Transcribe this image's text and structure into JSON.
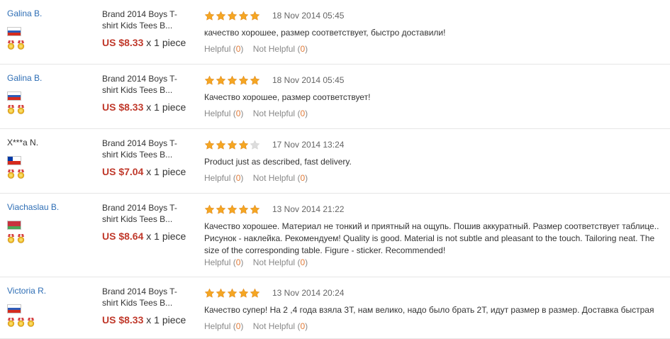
{
  "reviews": [
    {
      "username": "Galina B.",
      "username_link": true,
      "country": "ru",
      "medals": 2,
      "product_title": "Brand 2014 Boys T-shirt Kids Tees B...",
      "price": "US $8.33",
      "qty": " x 1 piece",
      "rating": 5,
      "date": "18 Nov 2014 05:45",
      "feedback": "качество хорошее, размер соответствует, быстро доставили!",
      "helpful_label": "Helpful",
      "helpful_count": "0",
      "not_helpful_label": "Not Helpful",
      "not_helpful_count": "0"
    },
    {
      "username": "Galina B.",
      "username_link": true,
      "country": "ru",
      "medals": 2,
      "product_title": "Brand 2014 Boys T-shirt Kids Tees B...",
      "price": "US $8.33",
      "qty": " x 1 piece",
      "rating": 5,
      "date": "18 Nov 2014 05:45",
      "feedback": "Качество хорошее, размер соответствует!",
      "helpful_label": "Helpful",
      "helpful_count": "0",
      "not_helpful_label": "Not Helpful",
      "not_helpful_count": "0"
    },
    {
      "username": "X***a N.",
      "username_link": false,
      "country": "cl",
      "medals": 2,
      "product_title": "Brand 2014 Boys T-shirt Kids Tees B...",
      "price": "US $7.04",
      "qty": " x 1 piece",
      "rating": 4,
      "date": "17 Nov 2014 13:24",
      "feedback": "Product just as described, fast delivery.",
      "helpful_label": "Helpful",
      "helpful_count": "0",
      "not_helpful_label": "Not Helpful",
      "not_helpful_count": "0"
    },
    {
      "username": "Viachaslau B.",
      "username_link": true,
      "country": "by",
      "medals": 2,
      "product_title": "Brand 2014 Boys T-shirt Kids Tees B...",
      "price": "US $8.64",
      "qty": " x 1 piece",
      "rating": 5,
      "date": "13 Nov 2014 21:22",
      "feedback": "Качество хорошее. Материал не тонкий и приятный на ощупь. Пошив аккуратный. Размер соответствует таблице.. Рисунок - наклейка. Рекомендуем! Quality is good. Material is not subtle and pleasant to the touch. Tailoring neat. The size of the corresponding table. Figure - sticker. Recommended!",
      "helpful_label": "Helpful",
      "helpful_count": "0",
      "not_helpful_label": "Not Helpful",
      "not_helpful_count": "0"
    },
    {
      "username": "Victoria R.",
      "username_link": true,
      "country": "ru",
      "medals": 3,
      "product_title": "Brand 2014 Boys T-shirt Kids Tees B...",
      "price": "US $8.33",
      "qty": " x 1 piece",
      "rating": 5,
      "date": "13 Nov 2014 20:24",
      "feedback": "Качество супер! На 2 ,4 года взяла 3Т, нам велико, надо было брать 2Т, идут размер в размер. Доставка быстрая",
      "helpful_label": "Helpful",
      "helpful_count": "0",
      "not_helpful_label": "Not Helpful",
      "not_helpful_count": "0"
    }
  ],
  "colors": {
    "link": "#2e6eb5",
    "price": "#c0392b",
    "star_filled": "#f5a623",
    "star_empty": "#dddddd",
    "count": "#e07b39"
  }
}
